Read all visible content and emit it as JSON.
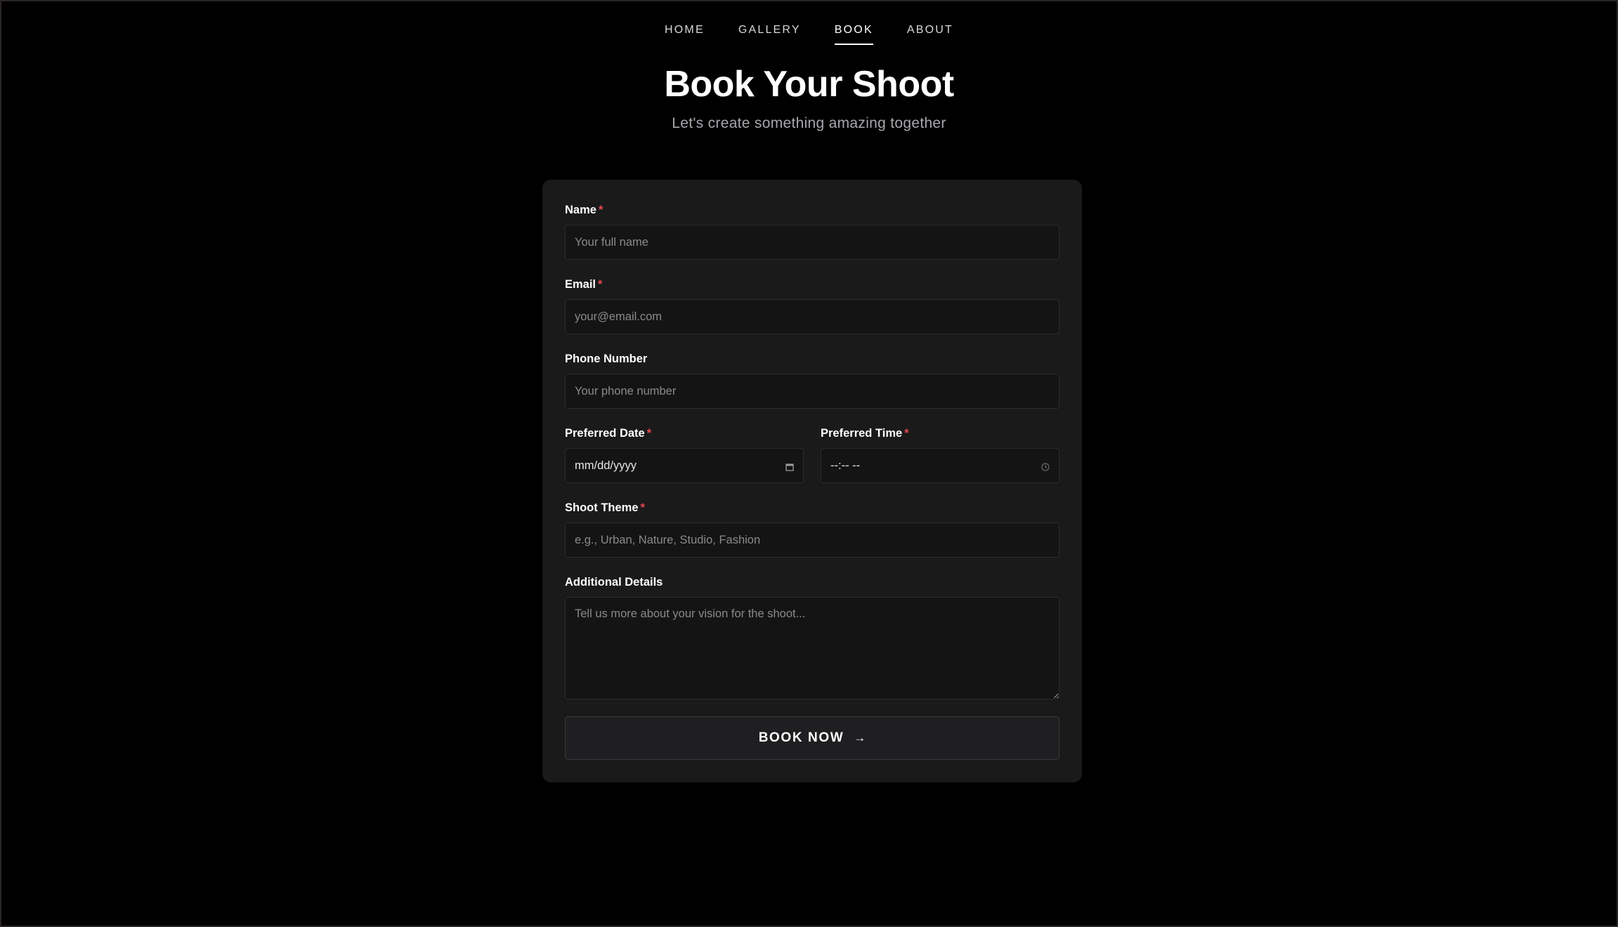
{
  "nav": {
    "items": [
      {
        "label": "HOME",
        "active": false
      },
      {
        "label": "GALLERY",
        "active": false
      },
      {
        "label": "BOOK",
        "active": true
      },
      {
        "label": "ABOUT",
        "active": false
      }
    ]
  },
  "header": {
    "title": "Book Your Shoot",
    "subtitle": "Let's create something amazing together"
  },
  "form": {
    "required_marker": "*",
    "name": {
      "label": "Name",
      "placeholder": "Your full name",
      "required": true
    },
    "email": {
      "label": "Email",
      "placeholder": "your@email.com",
      "required": true
    },
    "phone": {
      "label": "Phone Number",
      "placeholder": "Your phone number",
      "required": false
    },
    "date": {
      "label": "Preferred Date",
      "value": "mm/dd/yyyy",
      "required": true,
      "icon": "calendar-icon"
    },
    "time": {
      "label": "Preferred Time",
      "value": "--:-- --",
      "required": true,
      "icon": "clock-icon"
    },
    "theme": {
      "label": "Shoot Theme",
      "placeholder": "e.g., Urban, Nature, Studio, Fashion",
      "required": true
    },
    "details": {
      "label": "Additional Details",
      "placeholder": "Tell us more about your vision for the shoot...",
      "required": false
    },
    "submit": {
      "label": "BOOK NOW",
      "icon": "arrow-right-icon",
      "arrow": "→"
    }
  },
  "colors": {
    "background": "#000000",
    "card": "#1a1a1a",
    "input_bg": "#141414",
    "required": "#e5484d",
    "muted_text": "#a7a7ad"
  }
}
